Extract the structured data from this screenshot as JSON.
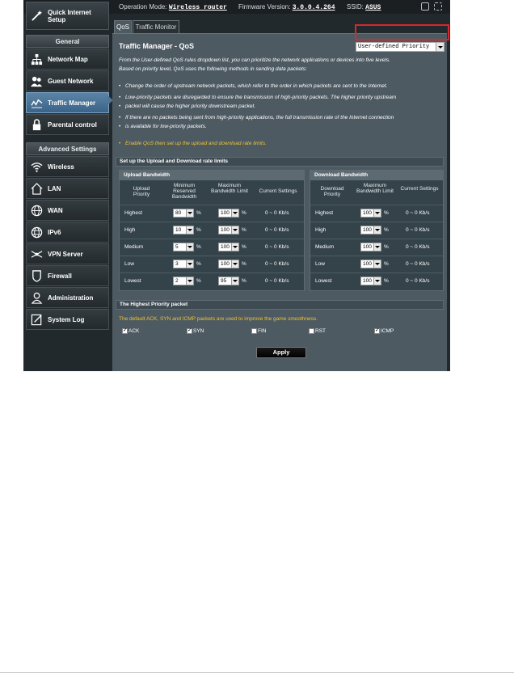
{
  "topbar": {
    "op_mode_label": "Operation Mode:",
    "op_mode_value": "Wireless router",
    "fw_label": "Firmware Version:",
    "fw_value": "3.0.0.4.264",
    "ssid_label": "SSID:",
    "ssid_value": "ASUS",
    "icons": [
      "logout-icon",
      "copy-icon"
    ]
  },
  "sidebar": {
    "quick_setup": "Quick Internet Setup",
    "general_header": "General",
    "general_items": [
      {
        "label": "Network Map",
        "icon": "network-map-icon"
      },
      {
        "label": "Guest Network",
        "icon": "guest-network-icon"
      },
      {
        "label": "Traffic Manager",
        "icon": "traffic-manager-icon",
        "active": true
      },
      {
        "label": "Parental control",
        "icon": "lock-icon"
      }
    ],
    "advanced_header": "Advanced Settings",
    "advanced_items": [
      {
        "label": "Wireless",
        "icon": "wifi-icon"
      },
      {
        "label": "LAN",
        "icon": "home-icon"
      },
      {
        "label": "WAN",
        "icon": "globe-icon"
      },
      {
        "label": "IPv6",
        "icon": "ipv6-globe-icon"
      },
      {
        "label": "VPN Server",
        "icon": "vpn-icon"
      },
      {
        "label": "Firewall",
        "icon": "shield-icon"
      },
      {
        "label": "Administration",
        "icon": "person-icon"
      },
      {
        "label": "System Log",
        "icon": "log-icon"
      }
    ]
  },
  "tabs": [
    {
      "label": "QoS",
      "active": true
    },
    {
      "label": "Traffic Monitor",
      "active": false
    }
  ],
  "panel": {
    "title": "Traffic Manager - QoS",
    "mode_select": "User-defined Priority",
    "intro_1": "From the User-defined QoS rules dropdown list, you can prioritize the network applications or devices into five levels.",
    "intro_2": "Based on priority level, QoS uses the following methods in sending data packets:",
    "bullets": [
      "Change the order of upstream network packets, which refer to the order in which packets are sent to the Internet.",
      "Low-priority packets are disregarded to ensure the transmission of high-priority packets. The higher priority upstream",
      "packet will cause the higher priority downstream packet.",
      "If there are no packets being sent from high-priority applications, the full transmission rate of the Internet connection",
      "is available for low-priority packets.",
      "Enable QoS then set up the upload and download rate limits."
    ],
    "rate_section_title": "Set up the Upload and Download rate limits",
    "upload": {
      "header": "Upload Bandwidth",
      "col_priority": "Upload Priority",
      "col_min": "Minimum Reserved Bandwidth",
      "col_max": "Maximum Bandwidth Limit",
      "col_current": "Current Settings",
      "pct": "%",
      "rows": [
        {
          "priority": "Highest",
          "min": "80",
          "max": "100",
          "current": "0 ~ 0 Kb/s"
        },
        {
          "priority": "High",
          "min": "10",
          "max": "100",
          "current": "0 ~ 0 Kb/s"
        },
        {
          "priority": "Medium",
          "min": "5",
          "max": "100",
          "current": "0 ~ 0 Kb/s"
        },
        {
          "priority": "Low",
          "min": "3",
          "max": "100",
          "current": "0 ~ 0 Kb/s"
        },
        {
          "priority": "Lowest",
          "min": "2",
          "max": "95",
          "current": "0 ~ 0 Kb/s"
        }
      ]
    },
    "download": {
      "header": "Download Bandwidth",
      "col_priority": "Download Priority",
      "col_max": "Maximum Bandwidth Limit",
      "col_current": "Current Settings",
      "pct": "%",
      "rows": [
        {
          "priority": "Highest",
          "max": "100",
          "current": "0 ~ 0 Kb/s"
        },
        {
          "priority": "High",
          "max": "100",
          "current": "0 ~ 0 Kb/s"
        },
        {
          "priority": "Medium",
          "max": "100",
          "current": "0 ~ 0 Kb/s"
        },
        {
          "priority": "Low",
          "max": "100",
          "current": "0 ~ 0 Kb/s"
        },
        {
          "priority": "Lowest",
          "max": "100",
          "current": "0 ~ 0 Kb/s"
        }
      ]
    },
    "hp_section_title": "The Highest Priority packet",
    "hp_desc": "The default ACK, SYN and ICMP packets are used to improve the game smoothness.",
    "packets": [
      {
        "label": "ACK",
        "checked": true
      },
      {
        "label": "SYN",
        "checked": true
      },
      {
        "label": "FIN",
        "checked": false
      },
      {
        "label": "RST",
        "checked": false
      },
      {
        "label": "ICMP",
        "checked": true
      }
    ],
    "apply_label": "Apply"
  },
  "colors": {
    "screen_bg": "#22292d",
    "panel_bg": "#4d5a62",
    "active_nav": "#4e7699",
    "highlight": "#f0c330",
    "callout_red": "#d8282a"
  }
}
